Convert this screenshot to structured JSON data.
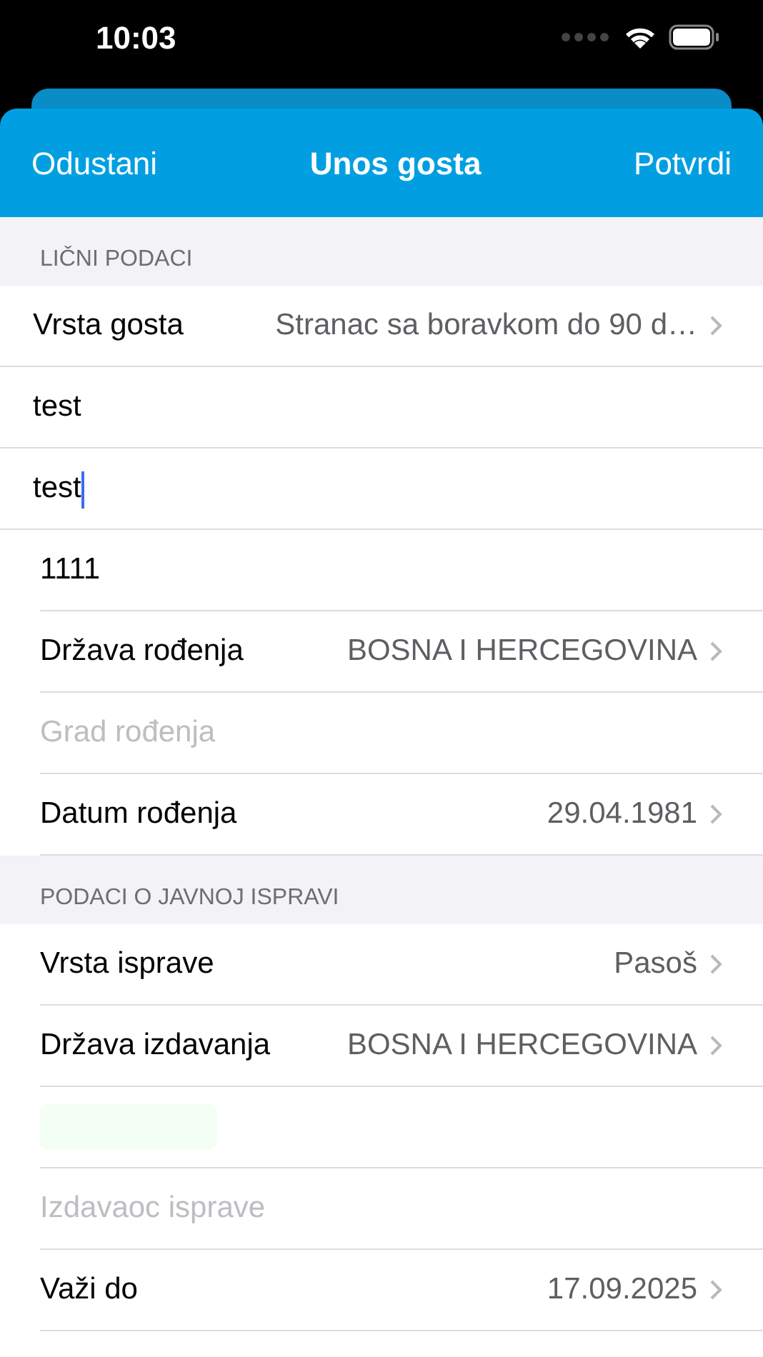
{
  "status_bar": {
    "time": "10:03"
  },
  "nav": {
    "left": "Odustani",
    "title": "Unos gosta",
    "right": "Potvrdi"
  },
  "sections": [
    {
      "header": "LIČNI PODACI",
      "rows": [
        {
          "kind": "select",
          "label": "Vrsta gosta",
          "value": "Stranac sa boravkom do 90 d…"
        },
        {
          "kind": "input",
          "value": "test",
          "focused": false
        },
        {
          "kind": "input",
          "value": "test",
          "focused": true
        },
        {
          "kind": "input",
          "value": "1111",
          "focused": false
        },
        {
          "kind": "select",
          "label": "Država rođenja",
          "value": "BOSNA I HERCEGOVINA"
        },
        {
          "kind": "input",
          "placeholder": "Grad rođenja",
          "focused": false
        },
        {
          "kind": "select",
          "label": "Datum rođenja",
          "value": "29.04.1981"
        }
      ]
    },
    {
      "header": "PODACI O JAVNOJ ISPRAVI",
      "rows": [
        {
          "kind": "select",
          "label": "Vrsta isprave",
          "value": "Pasoš"
        },
        {
          "kind": "select",
          "label": "Država izdavanja",
          "value": "BOSNA I HERCEGOVINA"
        },
        {
          "kind": "input",
          "highlighted": true
        },
        {
          "kind": "input",
          "placeholder": "Izdavaoc isprave",
          "focused": false
        },
        {
          "kind": "select",
          "label": "Važi do",
          "value": "17.09.2025"
        }
      ]
    }
  ]
}
